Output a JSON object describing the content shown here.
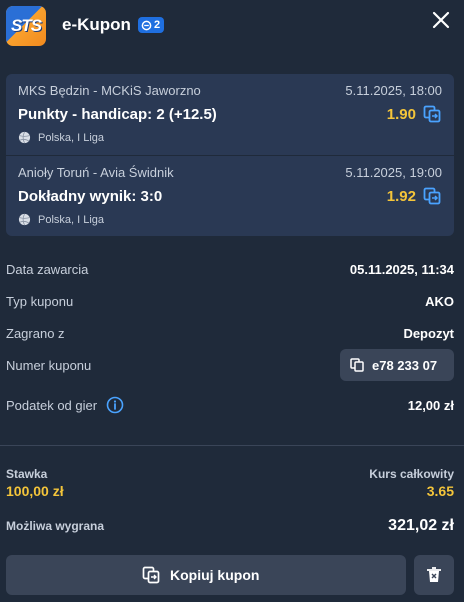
{
  "header": {
    "logo_text": "STS",
    "title": "e-Kupon",
    "badge_count": "2"
  },
  "events": [
    {
      "teams": "MKS Będzin - MCKiS Jaworzno",
      "date": "5.11.2025, 18:00",
      "market": "Punkty - handicap: 2 (+12.5)",
      "odds": "1.90",
      "league": "Polska, I Liga"
    },
    {
      "teams": "Anioły Toruń - Avia Świdnik",
      "date": "5.11.2025, 19:00",
      "market": "Dokładny wynik: 3:0",
      "odds": "1.92",
      "league": "Polska, I Liga"
    }
  ],
  "details": {
    "date_label": "Data zawarcia",
    "date_value": "05.11.2025, 11:34",
    "type_label": "Typ kuponu",
    "type_value": "AKO",
    "played_label": "Zagrano z",
    "played_value": "Depozyt",
    "number_label": "Numer kuponu",
    "number_value": "e78 233 07",
    "tax_label": "Podatek od gier",
    "tax_value": "12,00 zł"
  },
  "summary": {
    "stake_label": "Stawka",
    "stake_value": "100,00 zł",
    "odds_label": "Kurs całkowity",
    "odds_value": "3.65",
    "win_label": "Możliwa wygrana",
    "win_value": "321,02 zł"
  },
  "actions": {
    "copy_label": "Kopiuj kupon"
  },
  "colors": {
    "background": "#1f2a3a",
    "card": "#2a3954",
    "accent_odds": "#f4c53a",
    "icon_blue": "#4aa3ff",
    "button": "#3a4558"
  },
  "icons": [
    "sts-logo",
    "coupon-count-icon",
    "close-icon",
    "copy-odds-icon",
    "volleyball-icon",
    "info-icon",
    "copy-icon",
    "trash-icon"
  ]
}
